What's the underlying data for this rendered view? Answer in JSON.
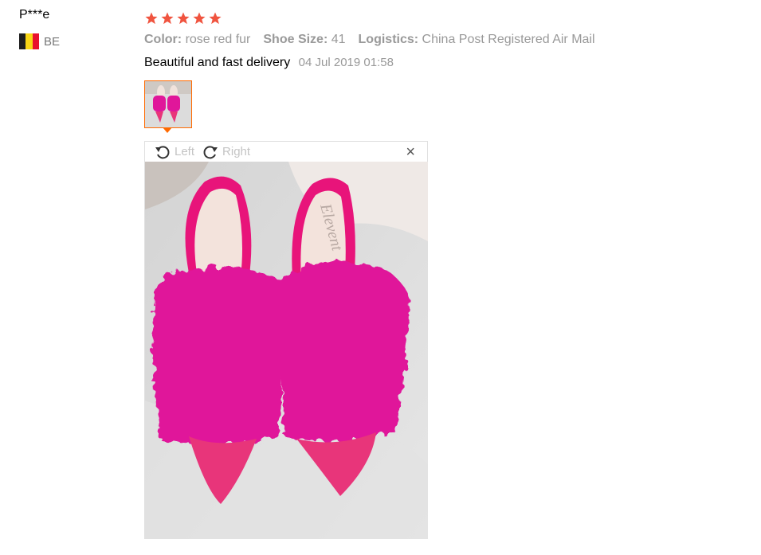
{
  "reviewer": {
    "name": "P***e",
    "country_code": "BE",
    "flag_colors": [
      "#1f1f1f",
      "#f9d616",
      "#e8112d"
    ]
  },
  "review": {
    "rating": 5,
    "star_color": "#f0543f",
    "attributes": [
      {
        "key": "Color:",
        "value": "rose red fur"
      },
      {
        "key": "Shoe Size:",
        "value": "41"
      },
      {
        "key": "Logistics:",
        "value": "China Post Registered Air Mail"
      }
    ],
    "feedback_text": "Beautiful and fast delivery",
    "date": "04 Jul 2019 01:58"
  },
  "viewer": {
    "rotate_left_label": "Left",
    "rotate_right_label": "Right",
    "close_symbol": "×",
    "accent_color": "#ff6a00",
    "shoe_color": "#e0169a",
    "insole_brand": "Elevent"
  }
}
